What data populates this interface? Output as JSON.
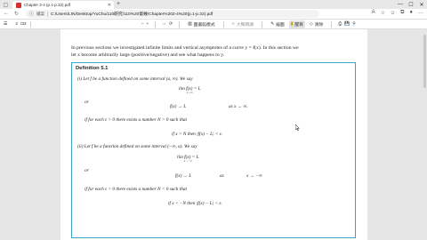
{
  "browser": {
    "tab_title": "Chapter 2-4 (p.1-p.32).pdf",
    "new_tab": "+",
    "window_controls": [
      "—",
      "☐",
      "✕"
    ],
    "address": {
      "file_label": "檔案",
      "url": "C:/Users/LIN/Desktop/YuChu/110研究/110%20第幾/Chapter%202-4%20(p.1-p.32).pdf"
    }
  },
  "pdf_toolbar": {
    "page_current": "2",
    "page_total": "/32",
    "zoom_minus": "−",
    "zoom_plus": "+",
    "view_label": "圖書館模式",
    "read_aloud_label": "大聲朗讀",
    "draw_label": "繪圖",
    "highlight_label": "醒目",
    "erase_label": "清除",
    "print_label": "列印"
  },
  "document": {
    "intro_line1": "In previous sections we investigated infinite limits and vertical asymptotes of a curve y = f(x). In this section we",
    "intro_line2": "let x become arbitrarily large (positive/negative) and see what happens to y.",
    "definition_title": "Definition 5.1",
    "part_i_text": "(i)  Let f be a function defined on some interval (a, ∞). We say",
    "part_i_limit": "lim f(x) = L",
    "part_i_limit_sub": "x→∞",
    "or_1": "or",
    "part_i_alt_left": "f(x) → L",
    "part_i_alt_right": "as  x → ∞.",
    "part_i_cond": "if for each ε > 0 there exists a number N > 0 such that",
    "part_i_if": "if     x > N     then     |f(x) − L| < ε.",
    "part_ii_text": "(ii)  Let f be a function defined on some interval (−∞, a). We say",
    "part_ii_limit": "lim f(x) = L",
    "part_ii_limit_sub": "x→−∞",
    "or_2": "or",
    "part_ii_alt_left": "f(x) → L",
    "part_ii_alt_mid": "as",
    "part_ii_alt_right": "x → −∞",
    "part_ii_cond": "if for each ε > 0 there exists a number N < 0 such that",
    "part_ii_if": "if     x < −N     then     |f(x) − L| < ε."
  }
}
